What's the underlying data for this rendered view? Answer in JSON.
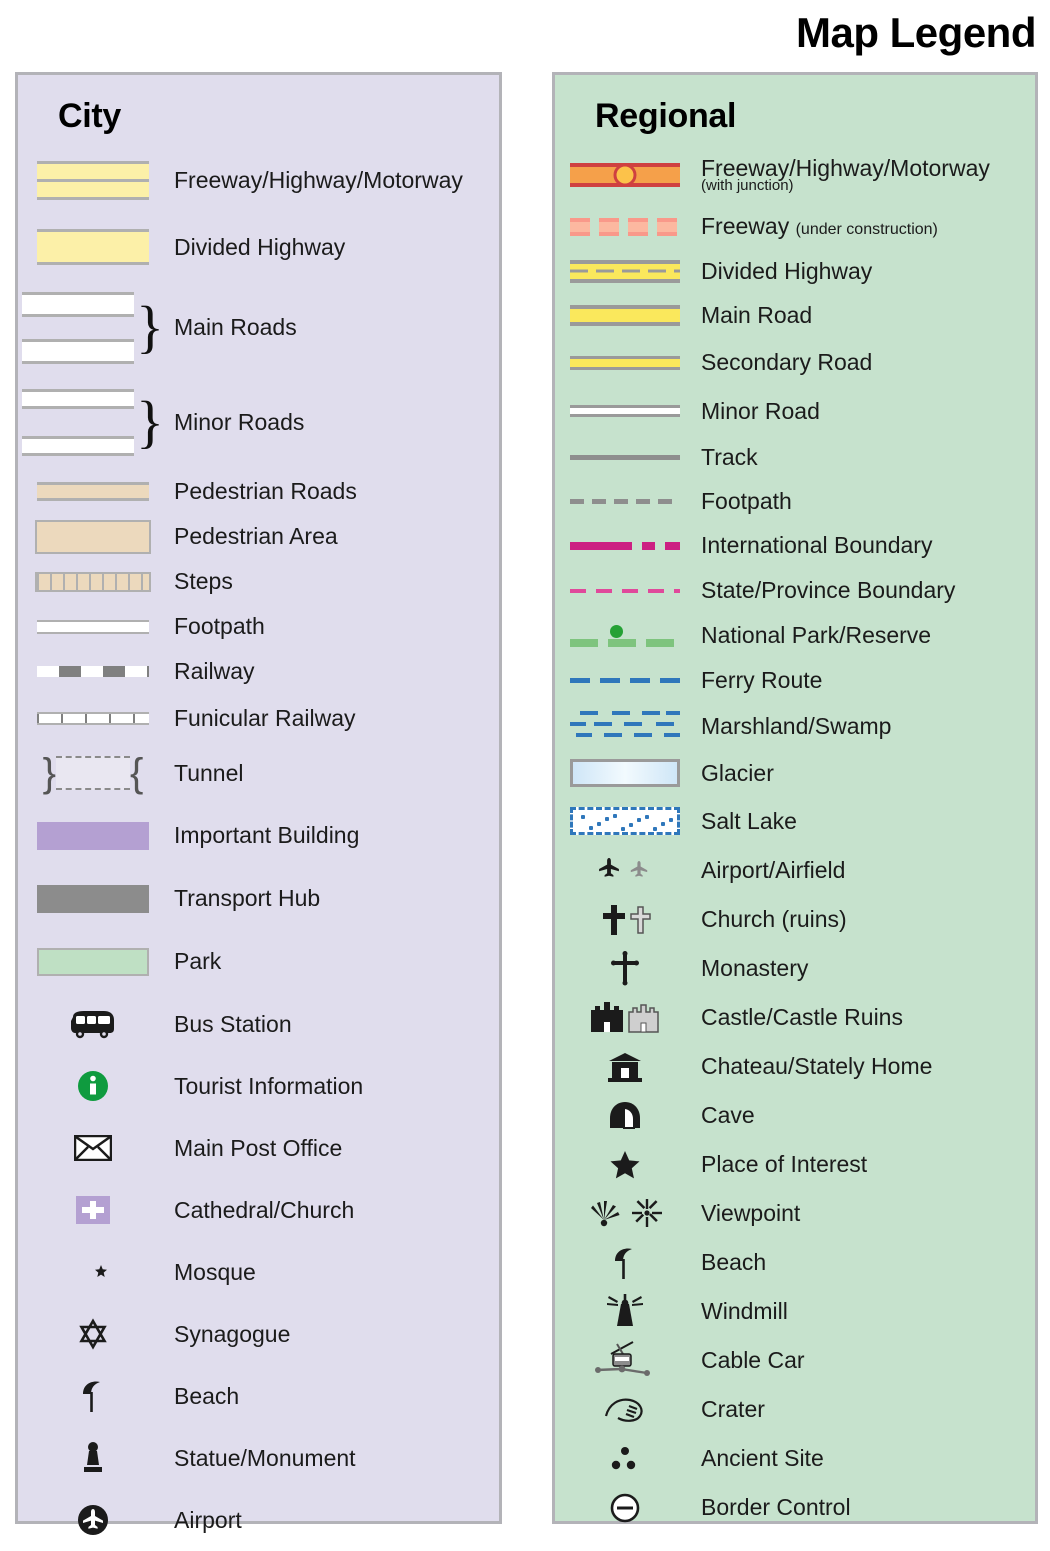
{
  "title": "Map Legend",
  "city": {
    "heading": "City",
    "background": "#e0dded",
    "items": [
      {
        "label": "Freeway/Highway/Motorway",
        "symbol": "city-freeway-swatch"
      },
      {
        "label": "Divided Highway",
        "symbol": "city-divided-highway-swatch"
      },
      {
        "label": "Main Roads",
        "symbol": "city-main-roads-swatch"
      },
      {
        "label": "Minor Roads",
        "symbol": "city-minor-roads-swatch"
      },
      {
        "label": "Pedestrian Roads",
        "symbol": "city-pedestrian-road-swatch"
      },
      {
        "label": "Pedestrian Area",
        "symbol": "city-pedestrian-area-swatch"
      },
      {
        "label": "Steps",
        "symbol": "city-steps-swatch"
      },
      {
        "label": "Footpath",
        "symbol": "city-footpath-swatch"
      },
      {
        "label": "Railway",
        "symbol": "city-railway-swatch"
      },
      {
        "label": "Funicular Railway",
        "symbol": "city-funicular-railway-swatch"
      },
      {
        "label": "Tunnel",
        "symbol": "city-tunnel-swatch"
      },
      {
        "label": "Important Building",
        "symbol": "city-important-building-swatch"
      },
      {
        "label": "Transport Hub",
        "symbol": "city-transport-hub-swatch"
      },
      {
        "label": "Park",
        "symbol": "city-park-swatch"
      },
      {
        "label": "Bus Station",
        "symbol": "bus-icon"
      },
      {
        "label": "Tourist Information",
        "symbol": "information-icon"
      },
      {
        "label": "Main Post Office",
        "symbol": "envelope-icon"
      },
      {
        "label": "Cathedral/Church",
        "symbol": "cross-square-icon"
      },
      {
        "label": "Mosque",
        "symbol": "star-and-crescent-icon"
      },
      {
        "label": "Synagogue",
        "symbol": "star-of-david-icon"
      },
      {
        "label": "Beach",
        "symbol": "beach-umbrella-icon"
      },
      {
        "label": "Statue/Monument",
        "symbol": "statue-icon"
      },
      {
        "label": "Airport",
        "symbol": "airport-circle-icon"
      }
    ]
  },
  "regional": {
    "heading": "Regional",
    "background": "#c6e2cd",
    "items": [
      {
        "label": "Freeway/Highway/Motorway",
        "sub": "(with junction)",
        "symbol": "regional-freeway-junction-swatch"
      },
      {
        "label": "Freeway",
        "sub": "(under construction)",
        "symbol": "regional-freeway-construction-swatch"
      },
      {
        "label": "Divided Highway",
        "symbol": "regional-divided-highway-swatch"
      },
      {
        "label": "Main Road",
        "symbol": "regional-main-road-swatch"
      },
      {
        "label": "Secondary Road",
        "symbol": "regional-secondary-road-swatch"
      },
      {
        "label": "Minor Road",
        "symbol": "regional-minor-road-swatch"
      },
      {
        "label": "Track",
        "symbol": "regional-track-swatch"
      },
      {
        "label": "Footpath",
        "symbol": "regional-footpath-swatch"
      },
      {
        "label": "International Boundary",
        "symbol": "international-boundary-swatch"
      },
      {
        "label": "State/Province Boundary",
        "symbol": "state-boundary-swatch"
      },
      {
        "label": "National Park/Reserve",
        "symbol": "national-park-swatch"
      },
      {
        "label": "Ferry Route",
        "symbol": "ferry-route-swatch"
      },
      {
        "label": "Marshland/Swamp",
        "symbol": "marshland-swatch"
      },
      {
        "label": "Glacier",
        "symbol": "glacier-swatch"
      },
      {
        "label": "Salt Lake",
        "symbol": "salt-lake-swatch"
      },
      {
        "label": "Airport/Airfield",
        "symbol": "airplane-icon"
      },
      {
        "label": "Church (ruins)",
        "symbol": "church-cross-icon"
      },
      {
        "label": "Monastery",
        "symbol": "monastery-cross-icon"
      },
      {
        "label": "Castle/Castle Ruins",
        "symbol": "castle-icon"
      },
      {
        "label": "Chateau/Stately Home",
        "symbol": "chateau-icon"
      },
      {
        "label": "Cave",
        "symbol": "cave-icon"
      },
      {
        "label": "Place of Interest",
        "symbol": "star-icon"
      },
      {
        "label": "Viewpoint",
        "symbol": "viewpoint-icon"
      },
      {
        "label": "Beach",
        "symbol": "beach-umbrella-icon"
      },
      {
        "label": "Windmill",
        "symbol": "windmill-icon"
      },
      {
        "label": "Cable Car",
        "symbol": "cable-car-icon"
      },
      {
        "label": "Crater",
        "symbol": "crater-icon"
      },
      {
        "label": "Ancient Site",
        "symbol": "ancient-site-icon"
      },
      {
        "label": "Border Control",
        "symbol": "border-control-icon"
      }
    ]
  },
  "colors": {
    "city_panel": "#e0dded",
    "regional_panel": "#c6e2cd",
    "highway_yellow": "#fcf0a8",
    "regional_yellow": "#fae85c",
    "freeway_red": "#cf4040",
    "freeway_orange": "#f5a04a",
    "junction_yellow": "#fcc24a",
    "pedestrian_tan": "#ecd9bd",
    "important_building_purple": "#b4a0d2",
    "transport_hub_gray": "#8c8c8c",
    "park_green": "#bfe0c4",
    "boundary_magenta": "#cc2082",
    "state_boundary_pink": "#e0499b",
    "national_park_green": "#7ec47e",
    "ferry_blue": "#2f77bb",
    "info_green": "#0f9b3f",
    "border_gray": "#b3b3b8"
  }
}
